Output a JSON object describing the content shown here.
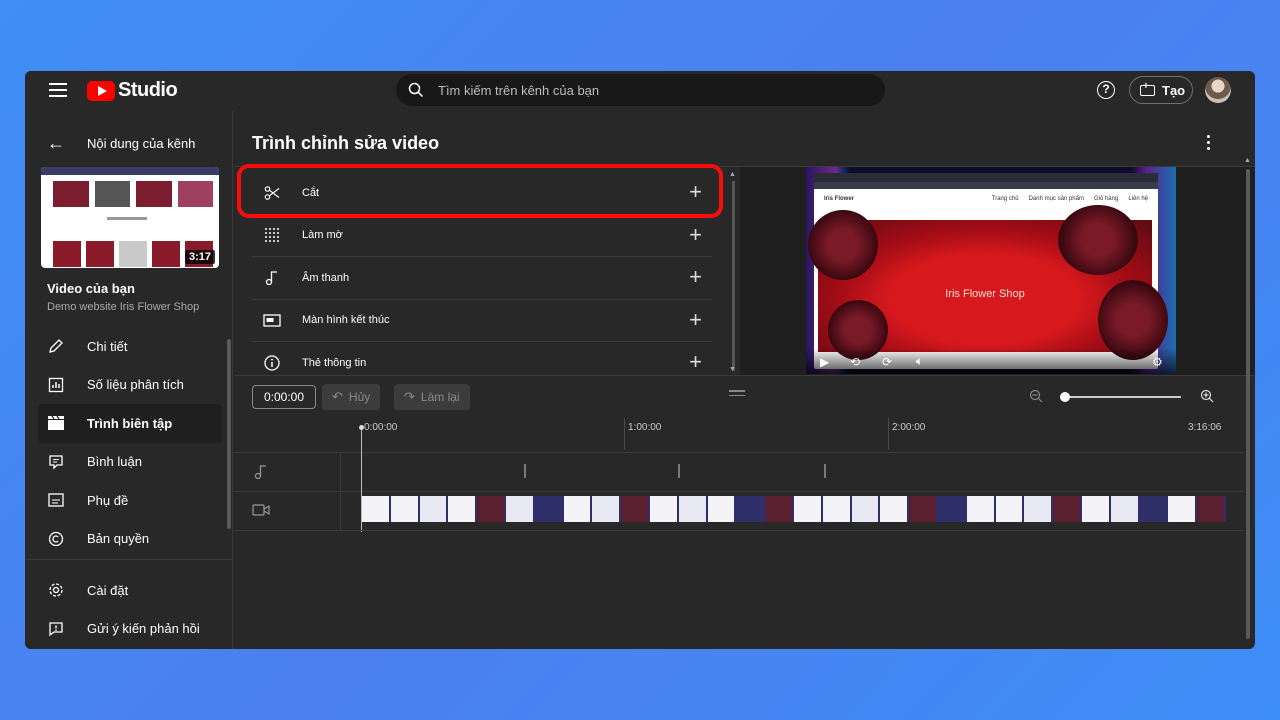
{
  "topbar": {
    "logo_text": "Studio",
    "search_placeholder": "Tìm kiếm trên kênh của bạn",
    "help_label": "?",
    "create_label": "Tạo"
  },
  "sidebar": {
    "back_label": "Nội dung của kênh",
    "thumb_duration": "3:17",
    "video_title": "Video của bạn",
    "video_subtitle": "Demo website Iris Flower Shop",
    "items": [
      {
        "label": "Chi tiết",
        "icon": "pencil-icon"
      },
      {
        "label": "Số liệu phân tích",
        "icon": "analytics-icon"
      },
      {
        "label": "Trình biên tập",
        "icon": "editor-icon",
        "active": true
      },
      {
        "label": "Bình luận",
        "icon": "comments-icon"
      },
      {
        "label": "Phụ đề",
        "icon": "subtitles-icon"
      },
      {
        "label": "Bản quyền",
        "icon": "copyright-icon"
      }
    ],
    "bottom_items": [
      {
        "label": "Cài đặt",
        "icon": "gear-icon"
      },
      {
        "label": "Gửi ý kiến phản hồi",
        "icon": "feedback-icon"
      }
    ]
  },
  "editor": {
    "title": "Trình chỉnh sửa video",
    "tools": [
      {
        "label": "Cắt",
        "icon": "scissors-icon"
      },
      {
        "label": "Làm mờ",
        "icon": "blur-icon"
      },
      {
        "label": "Âm thanh",
        "icon": "music-note-icon"
      },
      {
        "label": "Màn hình kết thúc",
        "icon": "end-screen-icon"
      },
      {
        "label": "Thẻ thông tin",
        "icon": "info-icon"
      }
    ],
    "preview": {
      "hero_text": "Iris Flower Shop",
      "site_logo": "Iris Flower",
      "nav_links": [
        "Trang chủ",
        "Danh mục sản phẩm",
        "Giỏ hàng",
        "Liên hệ"
      ]
    },
    "highlight_color": "#ff0a0a"
  },
  "timeline": {
    "current_time": "0:00:00",
    "undo_label": "Hủy",
    "redo_label": "Làm lại",
    "ticks": [
      "0:00:00",
      "1:00:00",
      "2:00:00",
      "3:16:06"
    ]
  }
}
